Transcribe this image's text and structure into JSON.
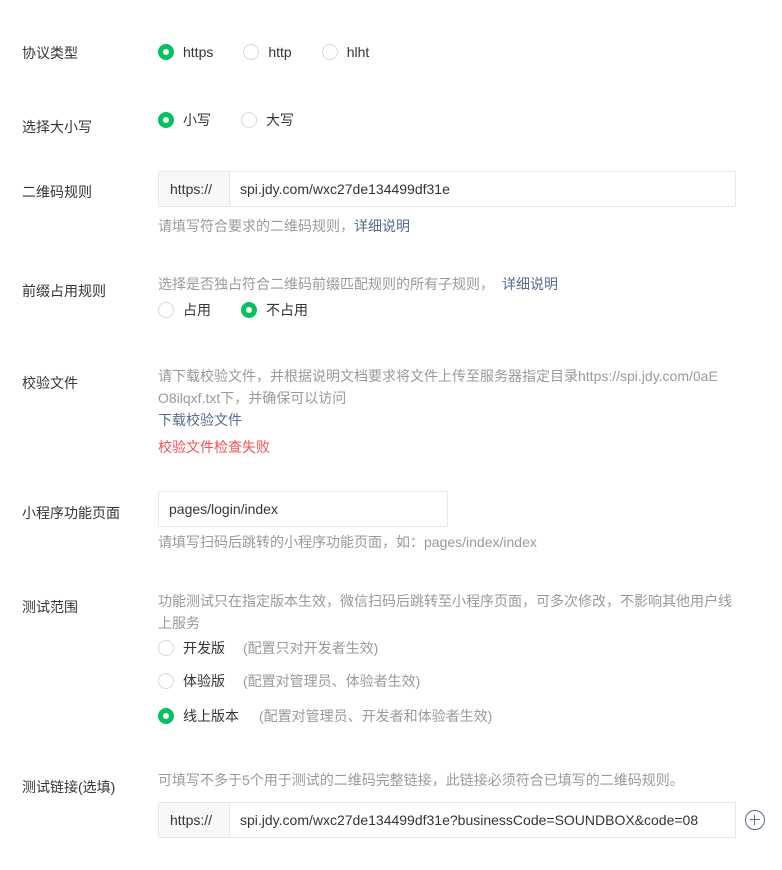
{
  "protocol": {
    "label": "协议类型",
    "options": [
      "https",
      "http",
      "hlht"
    ],
    "selected": "https"
  },
  "case": {
    "label": "选择大小写",
    "options": [
      "小写",
      "大写"
    ],
    "selected": "小写"
  },
  "qr_rule": {
    "label": "二维码规则",
    "prefix": "https://",
    "value": "spi.jdy.com/wxc27de134499df31e",
    "hint": "请填写符合要求的二维码规则，",
    "hint_link": "详细说明"
  },
  "prefix_rule": {
    "label": "前缀占用规则",
    "hint": "选择是否独占符合二维码前缀匹配规则的所有子规则，",
    "hint_link": "详细说明",
    "options": [
      "占用",
      "不占用"
    ],
    "selected": "不占用"
  },
  "verify_file": {
    "label": "校验文件",
    "hint_line1": "请下载校验文件，并根据说明文档要求将文件上传至服务器指定目录https://spi.jdy.com/0aE",
    "hint_line2": "O8ilqxf.txt下，并确保可以访问",
    "download_link": "下载校验文件",
    "error": "校验文件检查失败"
  },
  "miniapp_page": {
    "label": "小程序功能页面",
    "value": "pages/login/index",
    "hint": "请填写扫码后跳转的小程序功能页面，如：pages/index/index"
  },
  "test_scope": {
    "label": "测试范围",
    "hint_line1": "功能测试只在指定版本生效，微信扫码后跳转至小程序页面，可多次修改，不影响其他用户线",
    "hint_line2": "上服务",
    "options": [
      {
        "name": "开发版",
        "note": "(配置只对开发者生效)"
      },
      {
        "name": "体验版",
        "note": "(配置对管理员、体验者生效)"
      },
      {
        "name": "线上版本",
        "note": "(配置对管理员、开发者和体验者生效)"
      }
    ],
    "selected": "线上版本"
  },
  "test_link": {
    "label": "测试链接(选填)",
    "hint": "可填写不多于5个用于测试的二维码完整链接，此链接必须符合已填写的二维码规则。",
    "prefix": "https://",
    "value": "spi.jdy.com/wxc27de134499df31e?businessCode=SOUNDBOX&code=08"
  },
  "colors": {
    "accent_green": "#07c160",
    "link_blue": "#576b95",
    "error_red": "#fa5151",
    "hint_gray": "#9a9a9a"
  }
}
